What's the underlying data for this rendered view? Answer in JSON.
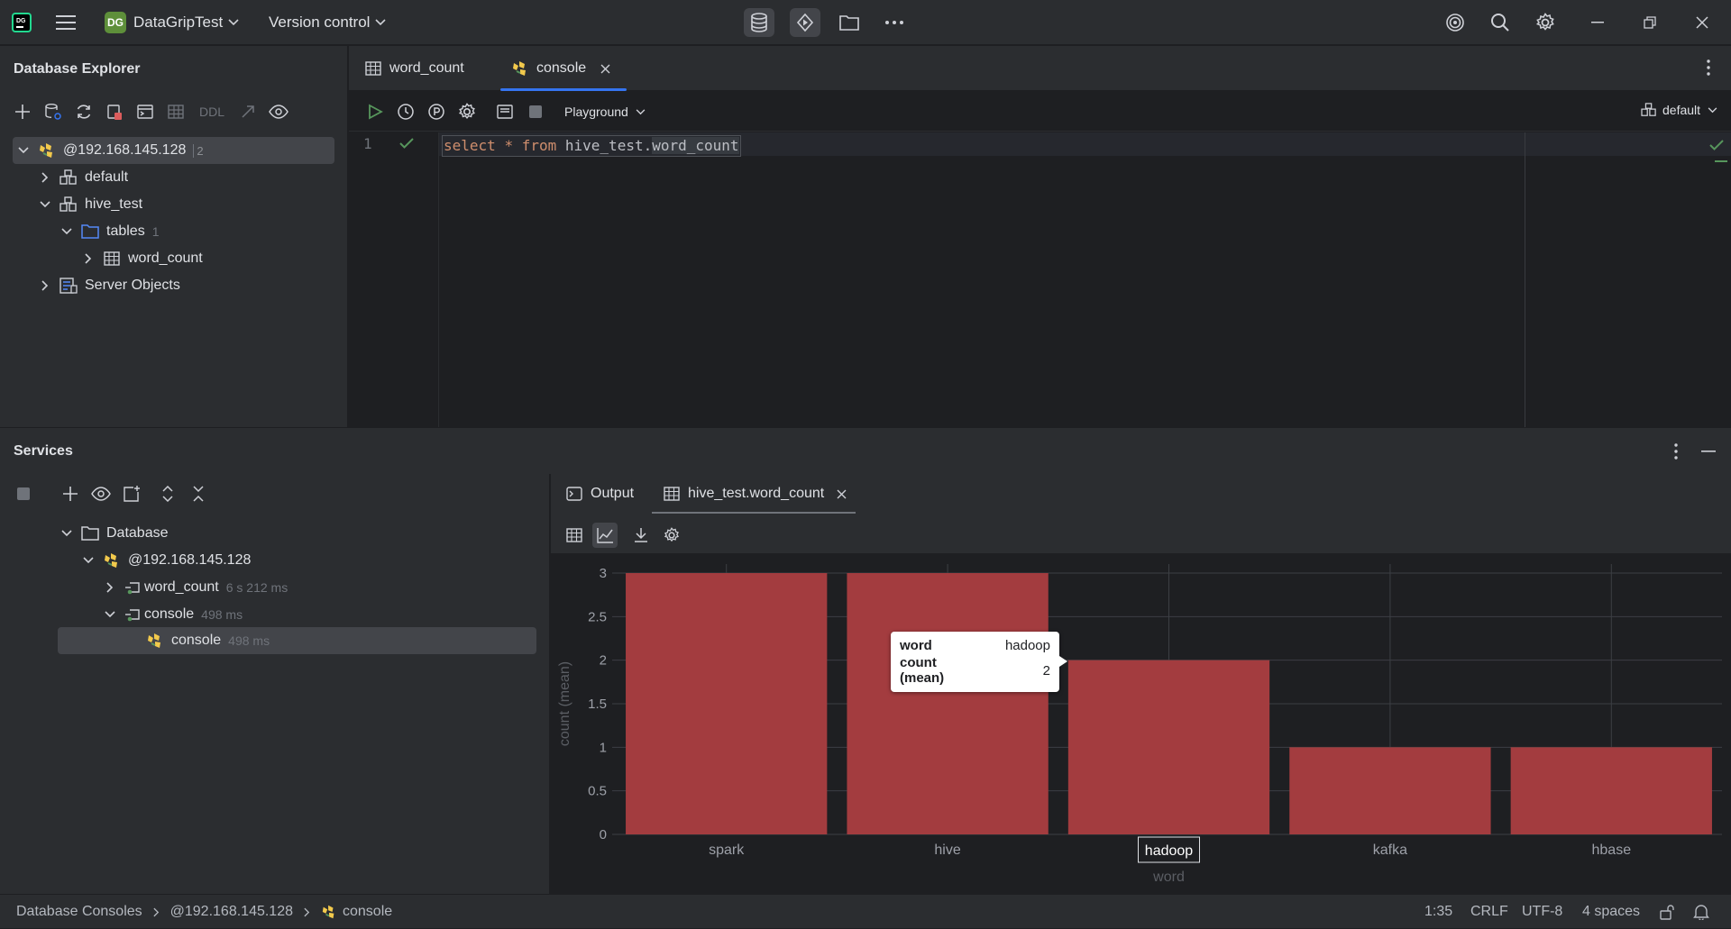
{
  "titlebar": {
    "project_badge": "DG",
    "project_name": "DataGripTest",
    "vcs": "Version control"
  },
  "db_explorer": {
    "title": "Database Explorer",
    "toolbar_ddl": "DDL",
    "tree": [
      {
        "label": "@192.168.145.128",
        "count": "2"
      },
      {
        "label": "default"
      },
      {
        "label": "hive_test"
      },
      {
        "label": "tables",
        "count": "1"
      },
      {
        "label": "word_count"
      },
      {
        "label": "Server Objects"
      }
    ]
  },
  "editor": {
    "tabs": [
      {
        "label": "word_count"
      },
      {
        "label": "console"
      }
    ],
    "playground": "Playground",
    "schema": "default",
    "line_number": "1",
    "code": {
      "kw1": "select",
      "star": "*",
      "kw2": "from",
      "schema": "hive_test",
      "dot": ".",
      "table": "word_count"
    }
  },
  "services": {
    "title": "Services",
    "tree": [
      {
        "label": "Database"
      },
      {
        "label": "@192.168.145.128"
      },
      {
        "label": "word_count",
        "time": "6 s 212 ms"
      },
      {
        "label": "console",
        "time": "498 ms"
      },
      {
        "label": "console",
        "time": "498 ms"
      }
    ],
    "result_tabs": [
      {
        "label": "Output"
      },
      {
        "label": "hive_test.word_count"
      }
    ]
  },
  "chart_data": {
    "type": "bar",
    "categories": [
      "spark",
      "hive",
      "hadoop",
      "kafka",
      "hbase"
    ],
    "values": [
      3,
      3,
      2,
      1,
      1
    ],
    "xlabel": "word",
    "ylabel": "count (mean)",
    "ylim": [
      0,
      3
    ],
    "yticks": [
      "0",
      "0.5",
      "1",
      "1.5",
      "2",
      "2.5",
      "3"
    ],
    "bar_color": "#a33c3f",
    "grid": true,
    "highlighted_category": "hadoop",
    "tooltip": {
      "rows": [
        {
          "key": "word",
          "value": "hadoop"
        },
        {
          "key": "count (mean)",
          "value": "2"
        }
      ]
    }
  },
  "statusbar": {
    "breadcrumb": [
      "Database Consoles",
      "@192.168.145.128",
      "console"
    ],
    "position": "1:35",
    "line_sep": "CRLF",
    "encoding": "UTF-8",
    "indent": "4 spaces"
  },
  "colors": {
    "accent": "#3574f0",
    "run_green": "#57965c",
    "keyword": "#cf8e6d",
    "hive_yellow": "#f2c94c"
  }
}
